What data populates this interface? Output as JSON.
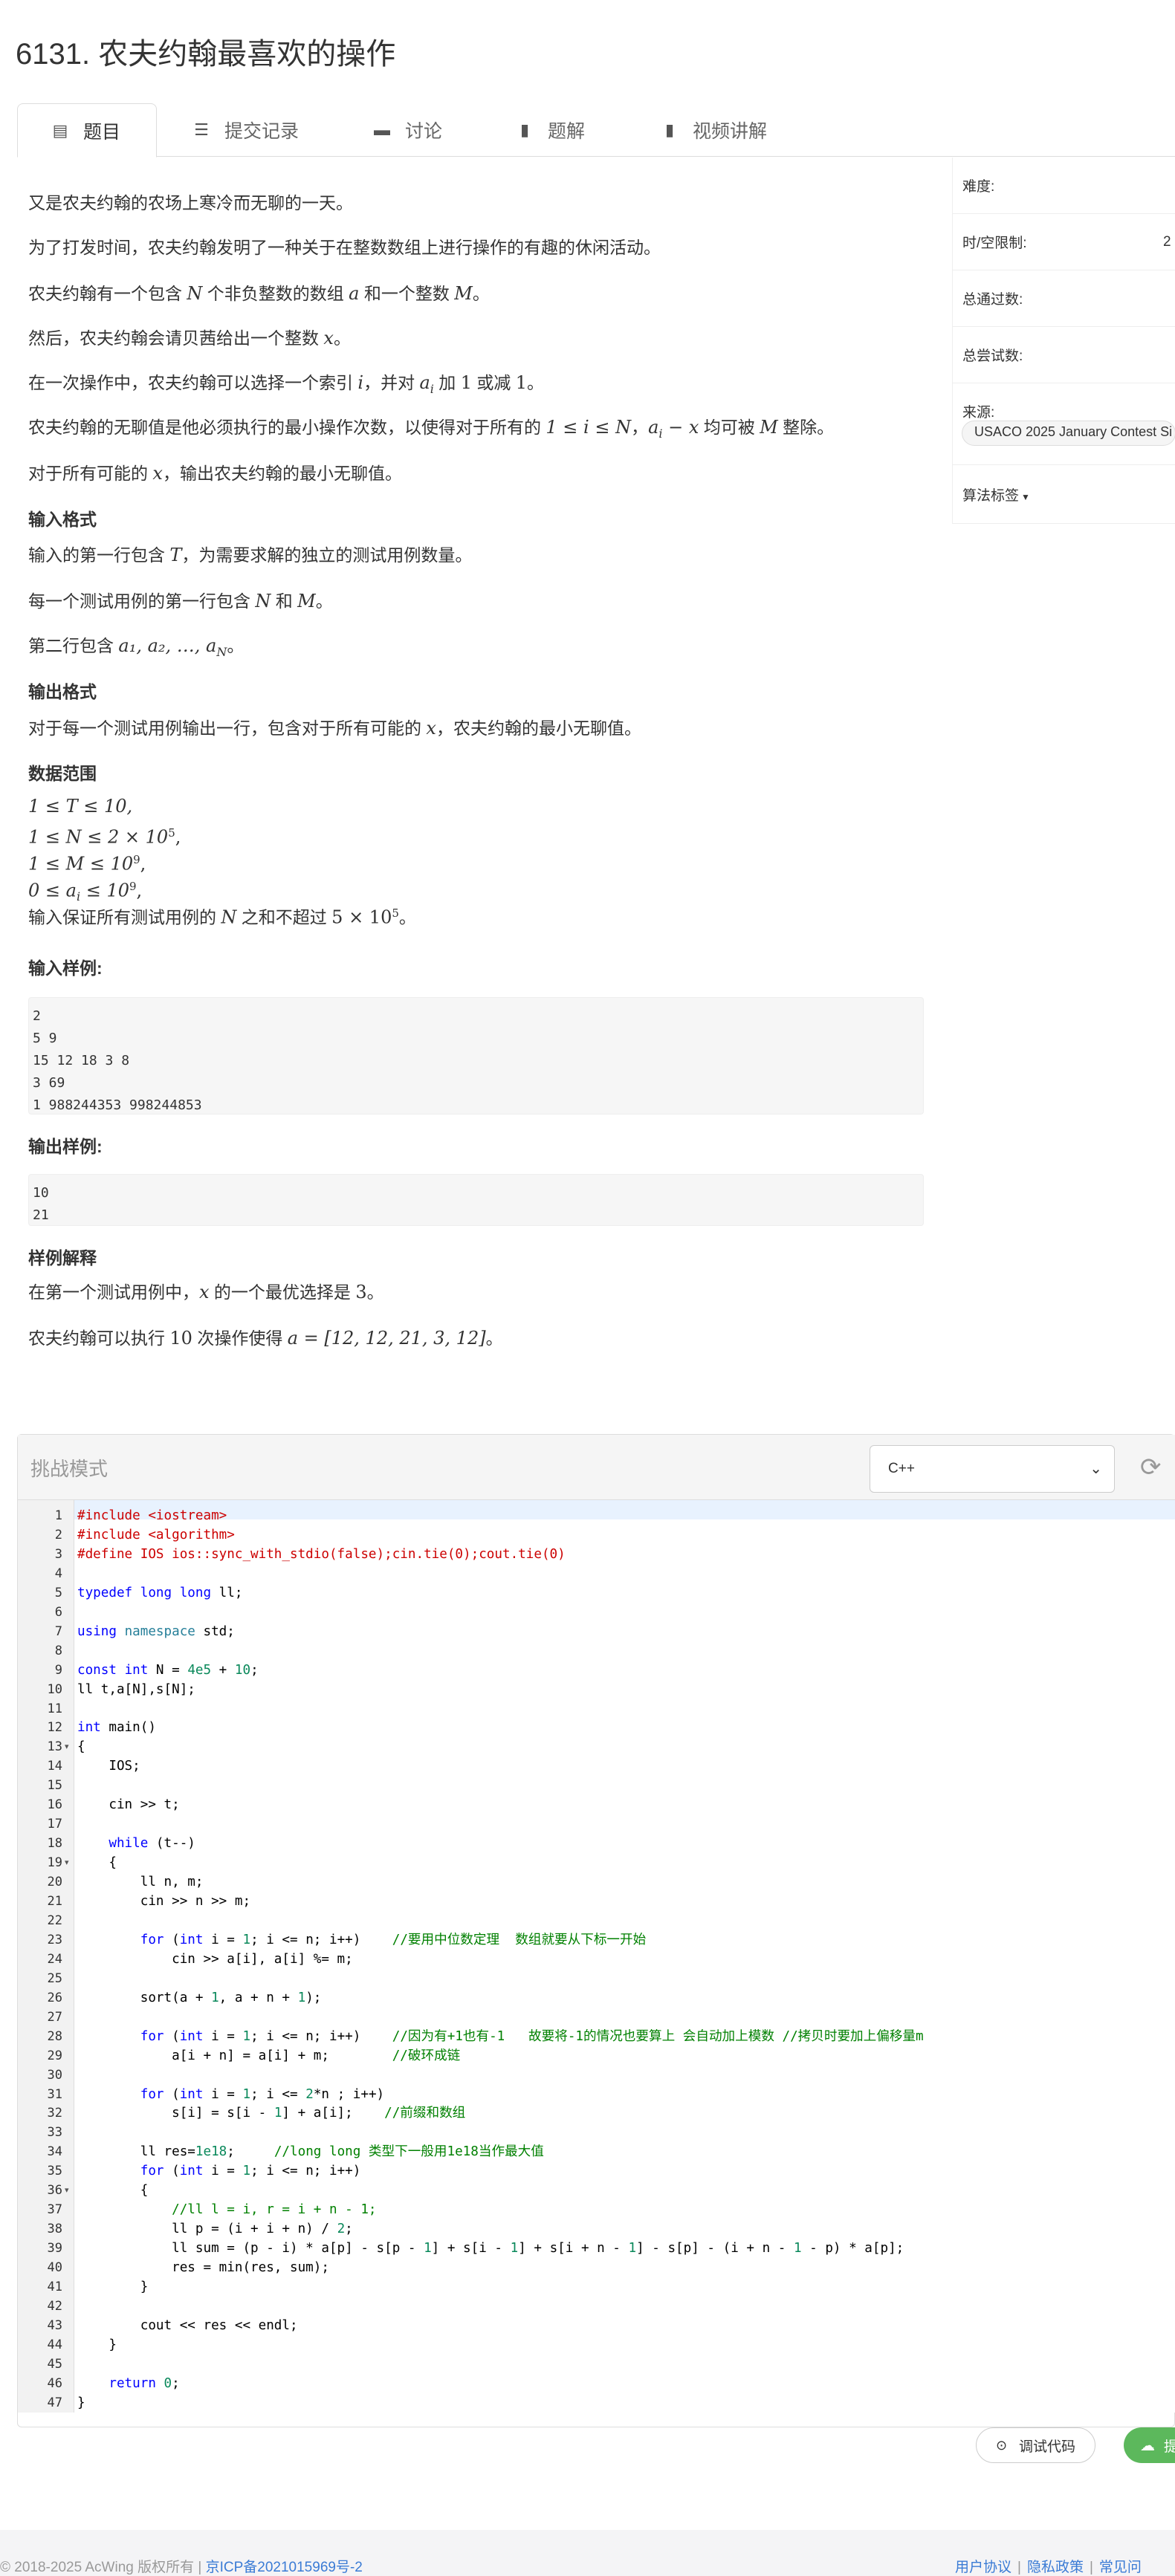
{
  "problem": {
    "title": "6131. 农夫约翰最喜欢的操作"
  },
  "tabs": [
    {
      "label": "题目",
      "icon": "file-icon"
    },
    {
      "label": "提交记录",
      "icon": "list-icon"
    },
    {
      "label": "讨论",
      "icon": "comment-icon"
    },
    {
      "label": "题解",
      "icon": "book-icon"
    },
    {
      "label": "视频讲解",
      "icon": "video-icon"
    }
  ],
  "statement": {
    "p1": "又是农夫约翰的农场上寒冷而无聊的一天。",
    "p2": "为了打发时间，农夫约翰发明了一种关于在整数数组上进行操作的有趣的休闲活动。",
    "p3a": "农夫约翰有一个包含 ",
    "p3N": "N",
    "p3b": " 个非负整数的数组 ",
    "p3a2": "a",
    "p3c": " 和一个整数 ",
    "p3M": "M",
    "p3d": "。",
    "p4a": "然后，农夫约翰会请贝茜给出一个整数 ",
    "p4x": "x",
    "p4b": "。",
    "p5a": "在一次操作中，农夫约翰可以选择一个索引 ",
    "p5i": "i",
    "p5b": "，并对 ",
    "p5ai": "a",
    "p5sub": "i",
    "p5c": " 加 ",
    "p5one": "1",
    "p5d": " 或减 ",
    "p5one2": "1",
    "p5e": "。",
    "p6a": "农夫约翰的无聊值是他必须执行的最小操作次数，以使得对于所有的 ",
    "p6expr": "1 ≤ i ≤ N",
    "p6b": "，",
    "p6expr2": "a",
    "p6sub": "i",
    "p6expr3": " − x",
    "p6c": " 均可被 ",
    "p6M": "M",
    "p6d": " 整除。",
    "p7a": "对于所有可能的 ",
    "p7x": "x",
    "p7b": "，输出农夫约翰的最小无聊值。",
    "h_in": "输入格式",
    "in1a": "输入的第一行包含 ",
    "in1T": "T",
    "in1b": "，为需要求解的独立的测试用例数量。",
    "in2a": "每一个测试用例的第一行包含 ",
    "in2N": "N",
    "in2b": " 和 ",
    "in2M": "M",
    "in2c": "。",
    "in3a": "第二行包含 ",
    "in3expr": "a₁, a₂, …, a",
    "in3sub": "N",
    "in3b": "。",
    "h_out": "输出格式",
    "out1a": "对于每一个测试用例输出一行，包含对于所有可能的 ",
    "out1x": "x",
    "out1b": "，农夫约翰的最小无聊值。",
    "h_range": "数据范围",
    "r1": "1 ≤ T ≤ 10,",
    "r2": "1 ≤ N ≤ 2 × 10",
    "r2sup": "5",
    "r2end": ",",
    "r3": "1 ≤ M ≤ 10",
    "r3sup": "9",
    "r3end": ",",
    "r4": "0 ≤ a",
    "r4sub": "i",
    "r4b": " ≤ 10",
    "r4sup": "9",
    "r4end": ",",
    "r5a": "输入保证所有测试用例的 ",
    "r5N": "N",
    "r5b": " 之和不超过 ",
    "r5expr": "5 × 10",
    "r5sup": "5",
    "r5c": "。",
    "h_sin": "输入样例:",
    "sample_in": "2\n5 9\n15 12 18 3 8\n3 69\n1 988244353 998244853",
    "h_sout": "输出样例:",
    "sample_out": "10\n21",
    "h_expl": "样例解释",
    "e1a": "在第一个测试用例中，",
    "e1x": "x",
    "e1b": " 的一个最优选择是 ",
    "e1v": "3",
    "e1c": "。",
    "e2a": "农夫约翰可以执行 ",
    "e2n": "10",
    "e2b": " 次操作使得 ",
    "e2expr": "a = [12, 12, 21, 3, 12]",
    "e2c": "。"
  },
  "sidebar": {
    "difficulty": "难度:",
    "limit": "时/空限制:",
    "limit_value": "2",
    "passed": "总通过数:",
    "attempts": "总尝试数:",
    "source": "来源:",
    "source_tag": "USACO 2025 January Contest Si",
    "algo_tags": "算法标签"
  },
  "editor": {
    "mode": "挑战模式",
    "language": "C++"
  },
  "buttons": {
    "debug": "调试代码",
    "submit": "提"
  },
  "footer": {
    "copyright": "© 2018-2025 AcWing 版权所有  |  ",
    "icp": "京ICP备2021015969号-2",
    "links": [
      "用户协议",
      "隐私政策",
      "常见问"
    ]
  }
}
